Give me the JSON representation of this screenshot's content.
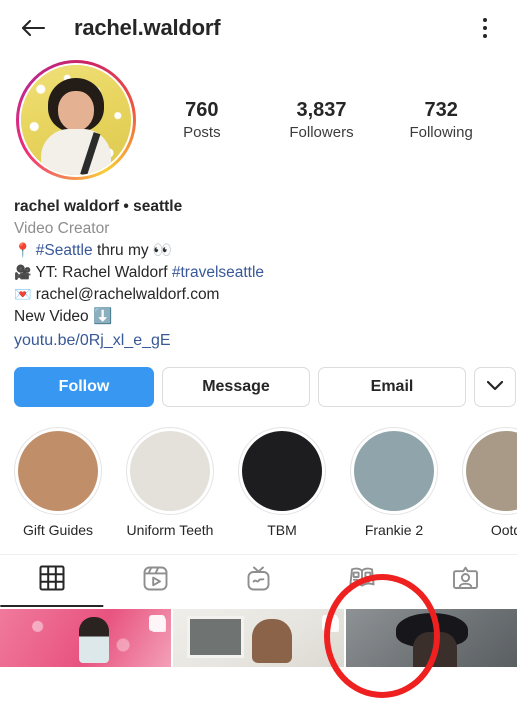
{
  "header": {
    "back_icon": "back-arrow-icon",
    "title": "rachel.waldorf",
    "menu_icon": "kebab-menu-icon"
  },
  "profile": {
    "avatar_alt": "rachel.waldorf profile photo",
    "stats": [
      {
        "value": "760",
        "label": "Posts"
      },
      {
        "value": "3,837",
        "label": "Followers"
      },
      {
        "value": "732",
        "label": "Following"
      }
    ]
  },
  "bio": {
    "display_name": "rachel waldorf • seattle",
    "category": "Video Creator",
    "lines": [
      {
        "emoji": "📍",
        "before": "",
        "link": "#Seattle",
        "after": " thru my 👀"
      },
      {
        "emoji": "🎥",
        "before": "YT: Rachel Waldorf ",
        "link": "#travelseattle",
        "after": ""
      },
      {
        "emoji": "💌",
        "before": "rachel@rachelwaldorf.com",
        "link": "",
        "after": ""
      },
      {
        "emoji": "",
        "before": "New Video ⬇️",
        "link": "",
        "after": ""
      }
    ],
    "url": "youtu.be/0Rj_xl_e_gE"
  },
  "actions": {
    "follow_label": "Follow",
    "message_label": "Message",
    "email_label": "Email",
    "more_icon": "chevron-down-icon"
  },
  "highlights": [
    {
      "label": "Gift Guides",
      "color": "#c08f6a"
    },
    {
      "label": "Uniform Teeth",
      "color": "#e4e1db"
    },
    {
      "label": "TBM",
      "color": "#1d1d20"
    },
    {
      "label": "Frankie 2",
      "color": "#8fa4ab"
    },
    {
      "label": "Ootd",
      "color": "#a89a86"
    }
  ],
  "tabs": [
    {
      "icon": "grid-icon",
      "name": "posts",
      "active": true
    },
    {
      "icon": "reels-icon",
      "name": "reels",
      "active": false
    },
    {
      "icon": "igtv-icon",
      "name": "igtv",
      "active": false
    },
    {
      "icon": "guides-icon",
      "name": "guides",
      "active": false
    },
    {
      "icon": "tagged-icon",
      "name": "tagged",
      "active": false
    }
  ],
  "posts": [
    {
      "alt": "pink room selfie post",
      "multi": true
    },
    {
      "alt": "interior portrait post",
      "multi": true
    },
    {
      "alt": "black hat portrait post",
      "multi": false
    }
  ],
  "annotation": {
    "shape": "circle",
    "color": "#ef2020",
    "target": "guides-tab"
  }
}
